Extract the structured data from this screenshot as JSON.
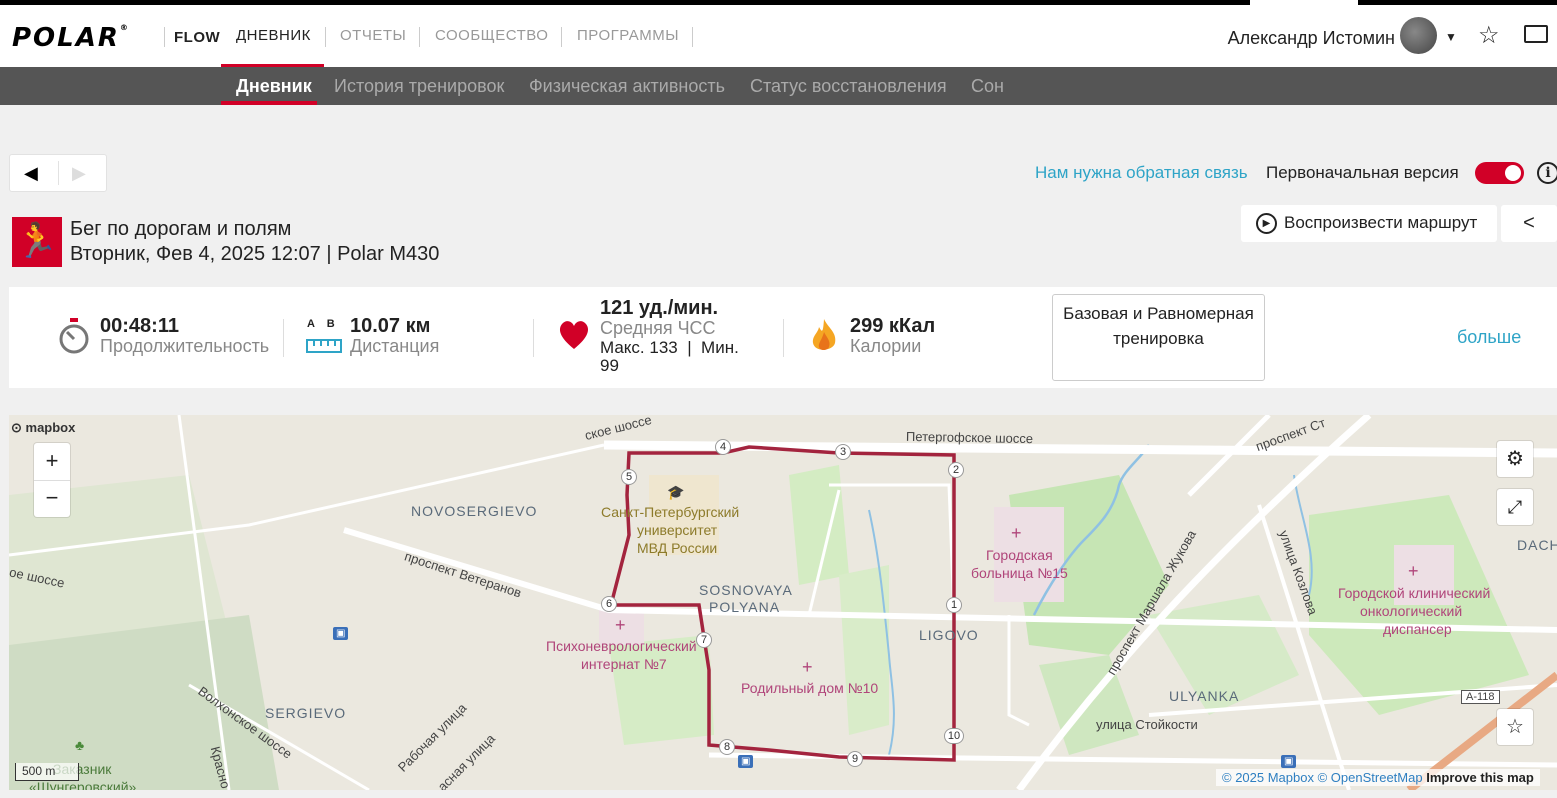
{
  "header": {
    "logo": "POLAR",
    "logo_reg": "®",
    "flow": "FLOW",
    "nav": [
      "ДНЕВНИК",
      "ОТЧЕТЫ",
      "СООБЩЕСТВО",
      "ПРОГРАММЫ"
    ],
    "user_name": "Александр Истомин"
  },
  "subnav": [
    "Дневник",
    "История тренировок",
    "Физическая активность",
    "Статус восстановления",
    "Сон"
  ],
  "toolbar": {
    "feedback": "Нам нужна обратная связь",
    "legacy_label": "Первоначальная версия",
    "legacy_on": true
  },
  "session": {
    "title": "Бег по дорогам и полям",
    "subtitle": "Вторник, Фев 4, 2025 12:07 | Polar M430",
    "replay_label": "Воспроизвести маршрут"
  },
  "stats": {
    "duration_value": "00:48:11",
    "duration_label": "Продолжительность",
    "distance_ab": "A    B",
    "distance_value": "10.07 км",
    "distance_label": "Дистанция",
    "hr_value": "121 уд./мин.",
    "hr_label": "Средняя ЧСС",
    "hr_minmax": "Макс. 133  |  Мин.",
    "hr_min": "99",
    "cal_value": "299 кКал",
    "cal_label": "Калории",
    "training_type": "Базовая и Равномерная тренировка",
    "more": "больше"
  },
  "map": {
    "mapbox": "mapbox",
    "scale": "500 m",
    "attribution_mapbox": "© 2025 Mapbox",
    "attribution_osm": "© OpenStreetMap",
    "attribution_improve": "Improve this map",
    "labels": {
      "peterhof_top": "Петергофское шоссе",
      "peterhof_left": "ское шоссе",
      "peterhof_far_left": "ое шоссе",
      "veteranov": "проспект Ветеранов",
      "volkhonskoe": "Волхонское шоссе",
      "novosergievo": "NOVOSERGIEVO",
      "sergievo": "SERGIEVO",
      "sosnovaya1": "SOSNOVAYA",
      "sosnovaya2": "POLYANA",
      "ligovo": "LIGOVO",
      "ulyanka": "ULYANKA",
      "dachno": "DACHNO",
      "univ1": "Санкт-Петербургский",
      "univ2": "университет",
      "univ3": "МВД России",
      "psycho1": "Психоневрологический",
      "psycho2": "интернат №7",
      "maternity": "Родильный дом №10",
      "hospital1": "Городская",
      "hospital2": "больница №15",
      "onco1": "Городской клинический",
      "onco2": "онкологический",
      "onco3": "диспансер",
      "zhukova": "проспект Маршала Жукова",
      "kozlova": "улица Козлова",
      "stoykosti": "улица Стойкости",
      "rabochaya": "Рабочая улица",
      "krasnoe": "Красно",
      "naslednaya": "асная улица",
      "zakaznik1": "Заказник",
      "zakaznik2": "«Шунгеровский»",
      "prospekt_st": "проспект Ст",
      "a118": "А-118"
    },
    "markers": [
      "1",
      "2",
      "3",
      "4",
      "5",
      "6",
      "7",
      "8",
      "9",
      "10"
    ],
    "route_color": "#a3243e"
  },
  "colors": {
    "accent": "#d10027",
    "link": "#2ea4c7"
  }
}
